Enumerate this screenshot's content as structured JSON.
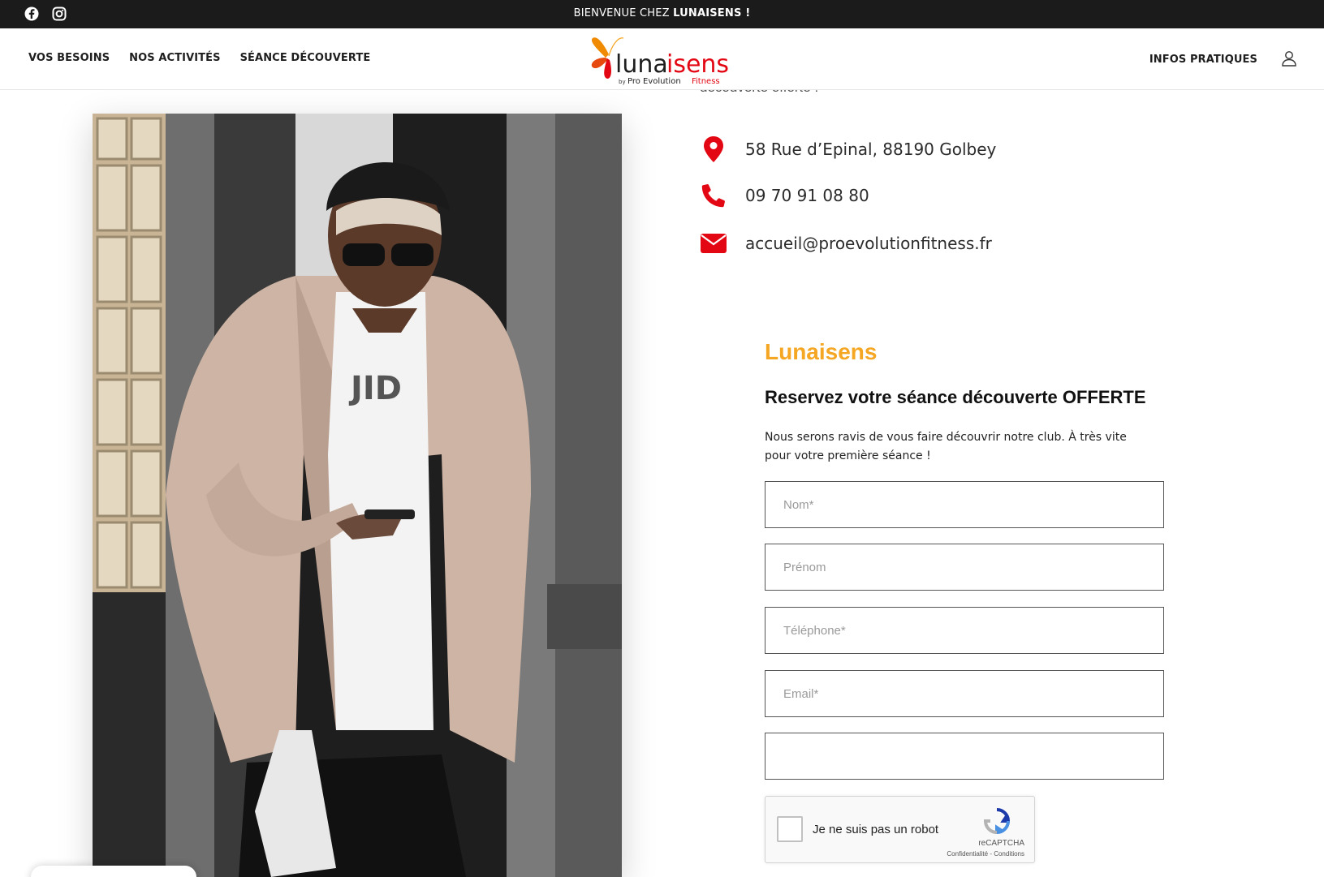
{
  "topbar": {
    "welcome_prefix": "BIENVENUE CHEZ ",
    "welcome_brand": "LUNAISENS !",
    "social": [
      "facebook-icon",
      "instagram-icon"
    ]
  },
  "header": {
    "nav_left": [
      "VOS BESOINS",
      "NOS ACTIVITÉS",
      "SÉANCE DÉCOUVERTE"
    ],
    "nav_right": "INFOS PRATIQUES",
    "logo": {
      "word_a": "luna",
      "word_b": "isens",
      "tagline_by": "by",
      "tagline_a": "Pro Evolution",
      "tagline_b": "Fitness"
    }
  },
  "clipped_text": "découverte offerte !",
  "contact": {
    "address": "58 Rue d’Epinal, 88190 Golbey",
    "phone": "09 70 91 08 80",
    "email": "accueil@proevolutionfitness.fr"
  },
  "form": {
    "brand": "Lunaisens",
    "title": "Reservez votre séance découverte OFFERTE",
    "description": "Nous serons ravis de vous faire découvrir notre club. À très vite pour votre première séance !",
    "fields": {
      "nom": "Nom*",
      "prenom": "Prénom",
      "telephone": "Téléphone*",
      "email": "Email*",
      "extra": ""
    },
    "captcha": {
      "label": "Je ne suis pas un robot",
      "brand": "reCAPTCHA",
      "links": "Confidentialité - Conditions"
    }
  },
  "photo": {
    "shirt_text": "JID"
  },
  "colors": {
    "accent_red": "#e30613",
    "brand_orange": "#f5a623",
    "topbar": "#1b1b1b"
  }
}
